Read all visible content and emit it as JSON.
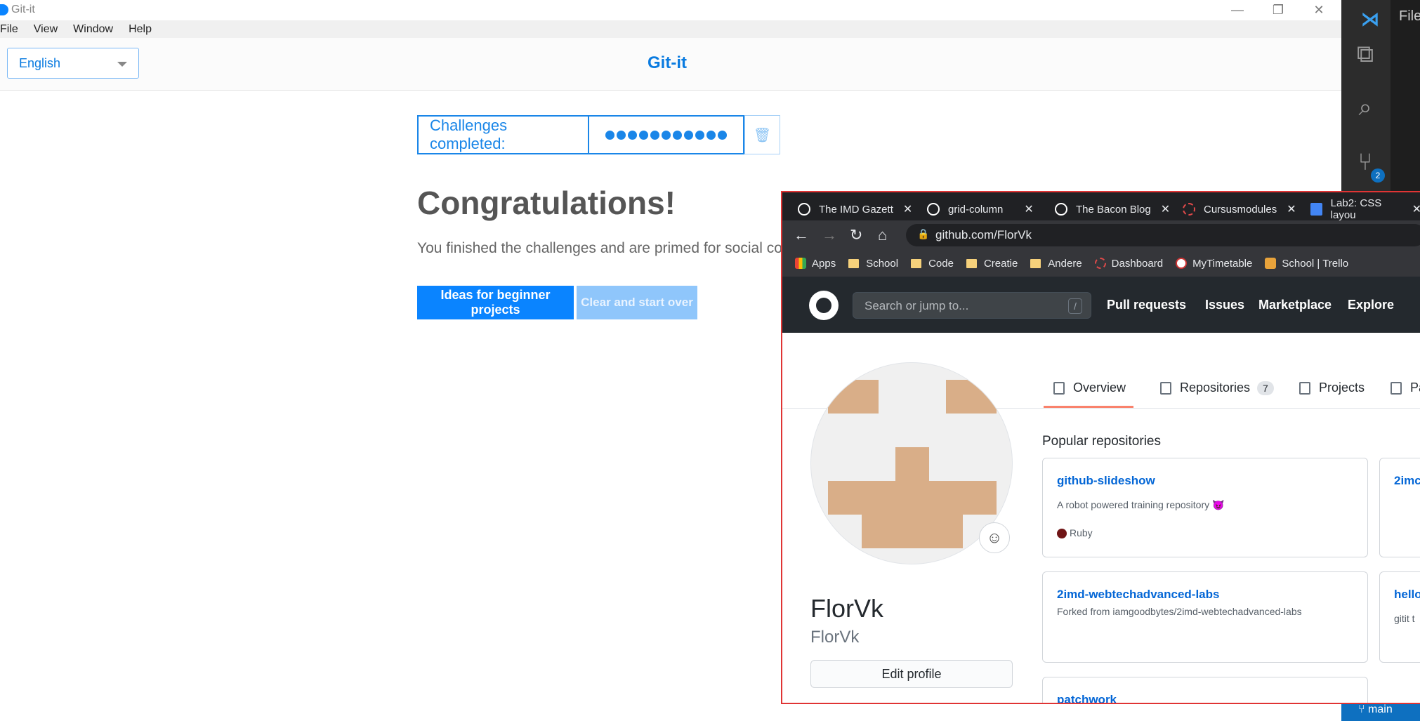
{
  "gitit": {
    "window_title": "Git-it",
    "menu": [
      "File",
      "View",
      "Window",
      "Help"
    ],
    "language_select": "English",
    "header_title": "Git-it",
    "progress_label": "Challenges completed:",
    "progress_count": 11,
    "congrats_title": "Congratulations!",
    "finished_text": "You finished the challenges and are primed for social cod",
    "btn_ideas": "Ideas for beginner projects",
    "btn_clear": "Clear and start over"
  },
  "vscode": {
    "file_menu": "File",
    "scm_badge": "2",
    "branch": "main"
  },
  "browser": {
    "tabs": [
      {
        "title": "The IMD Gazett"
      },
      {
        "title": "grid-column"
      },
      {
        "title": "The Bacon Blog"
      },
      {
        "title": "Cursusmodules"
      },
      {
        "title": "Lab2: CSS layou"
      }
    ],
    "url": "github.com/FlorVk",
    "bookmarks": [
      "Apps",
      "School",
      "Code",
      "Creatie",
      "Andere",
      "Dashboard",
      "MyTimetable",
      "School | Trello"
    ],
    "github": {
      "search_placeholder": "Search or jump to...",
      "search_shortcut": "/",
      "nav": [
        "Pull requests",
        "Issues",
        "Marketplace",
        "Explore"
      ],
      "tabs": {
        "overview": "Overview",
        "repositories": "Repositories",
        "repositories_count": "7",
        "projects": "Projects",
        "packages": "Pa"
      },
      "display_name": "FlorVk",
      "username": "FlorVk",
      "edit_profile": "Edit profile",
      "popular_heading": "Popular repositories",
      "repos": [
        {
          "name": "github-slideshow",
          "desc": "A robot powered training repository 😈",
          "lang": "Ruby"
        },
        {
          "name": "2imd-webtechadvanced-labs",
          "desc": "Forked from iamgoodbytes/2imd-webtechadvanced-labs",
          "lang": ""
        },
        {
          "name": "patchwork",
          "desc": "",
          "lang": ""
        }
      ],
      "repos_right": [
        {
          "name": "2imc",
          "desc": ""
        },
        {
          "name": "hello",
          "desc": "gitit t"
        }
      ]
    }
  },
  "colors": {
    "gitit_blue": "#0a84ff",
    "github_dark": "#24292e",
    "chrome_dark": "#202124",
    "vscode_blue": "#0e70c0"
  }
}
